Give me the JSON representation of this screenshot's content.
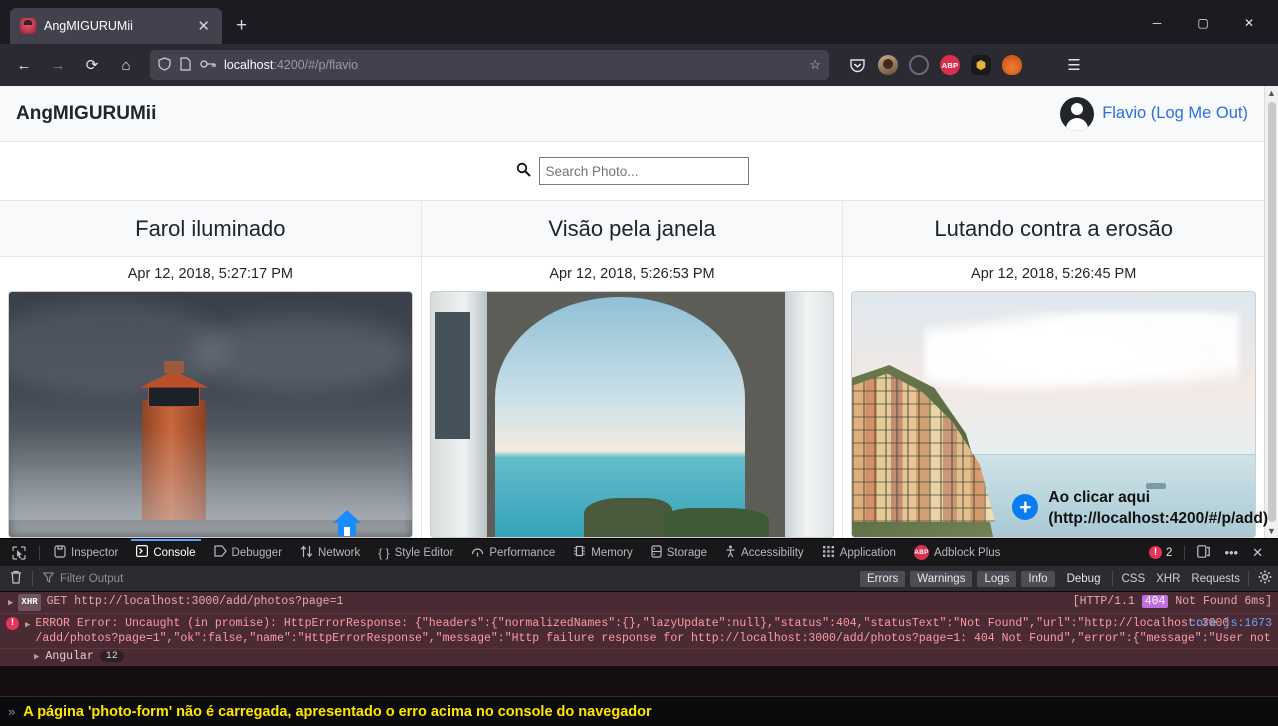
{
  "browser": {
    "tab": {
      "title": "AngMIGURUMii",
      "close_label": "✕",
      "favicon": "bug-favicon"
    },
    "newtab_label": "+",
    "window_controls": {
      "minimize": "─",
      "maximize": "▢",
      "close": "✕"
    },
    "nav": {
      "back": "←",
      "forward": "→",
      "reload": "⟳",
      "home": "⌂"
    },
    "url": {
      "protocol_host": "localhost",
      "rest": ":4200/#/p/flavio",
      "full": "localhost:4200/#/p/flavio"
    },
    "urlbar_icons": [
      "shield-icon",
      "page-icon",
      "key-icon"
    ],
    "bookmark_star": "☆",
    "extensions": [
      {
        "name": "pocket-icon",
        "glyph": ""
      },
      {
        "name": "profile-avatar-icon",
        "glyph": ""
      },
      {
        "name": "circle-extension-icon",
        "glyph": ""
      },
      {
        "name": "adblock-plus-icon",
        "glyph": "ABP"
      },
      {
        "name": "gold-extension-icon",
        "glyph": "⬢"
      },
      {
        "name": "metamask-fox-icon",
        "glyph": ""
      },
      {
        "name": "windows-extension-icon",
        "glyph": ""
      },
      {
        "name": "app-menu-icon",
        "glyph": "☰"
      }
    ]
  },
  "app": {
    "brand": "AngMIGURUMii",
    "user_link": "Flavio (Log Me Out)",
    "search": {
      "placeholder": "Search Photo...",
      "value": "",
      "icon": "search-icon"
    },
    "photos": [
      {
        "title": "Farol iluminado",
        "date": "Apr 12, 2018, 5:27:17 PM",
        "image": "lighthouse-storm-photo"
      },
      {
        "title": "Visão pela janela",
        "date": "Apr 12, 2018, 5:26:53 PM",
        "image": "stone-arch-sea-photo"
      },
      {
        "title": "Lutando contra a erosão",
        "date": "Apr 12, 2018, 5:26:45 PM",
        "image": "cliff-village-photo"
      }
    ],
    "home_button_icon": "home-icon",
    "annotation": {
      "plus_glyph": "+",
      "line1": "Ao clicar aqui",
      "line2": "(http://localhost:4200/#/p/add)"
    }
  },
  "devtools": {
    "picker_icon": "element-picker-icon",
    "tabs": [
      {
        "label": "Inspector",
        "icon": "inspector-icon",
        "active": false
      },
      {
        "label": "Console",
        "icon": "console-icon",
        "active": true
      },
      {
        "label": "Debugger",
        "icon": "debugger-icon",
        "active": false
      },
      {
        "label": "Network",
        "icon": "network-icon",
        "active": false
      },
      {
        "label": "Style Editor",
        "icon": "style-editor-icon",
        "active": false
      },
      {
        "label": "Performance",
        "icon": "performance-icon",
        "active": false
      },
      {
        "label": "Memory",
        "icon": "memory-icon",
        "active": false
      },
      {
        "label": "Storage",
        "icon": "storage-icon",
        "active": false
      },
      {
        "label": "Accessibility",
        "icon": "accessibility-icon",
        "active": false
      },
      {
        "label": "Application",
        "icon": "application-icon",
        "active": false
      },
      {
        "label": "Adblock Plus",
        "icon": "adblock-plus-icon",
        "active": false
      }
    ],
    "error_count": "2",
    "dock_icon": "dock-icon",
    "meatball_icon": "more-options-icon",
    "close_icon": "close-icon",
    "filterbar": {
      "trash_icon": "clear-console-icon",
      "filter_icon": "filter-icon",
      "filter_placeholder": "Filter Output",
      "buttons": [
        {
          "label": "Errors",
          "active": true
        },
        {
          "label": "Warnings",
          "active": true
        },
        {
          "label": "Logs",
          "active": true
        },
        {
          "label": "Info",
          "active": true
        },
        {
          "label": "Debug",
          "active": false
        }
      ],
      "extra": [
        "CSS",
        "XHR",
        "Requests"
      ],
      "settings_icon": "gear-icon"
    },
    "logs": {
      "network": {
        "method_url": "GET http://localhost:3000/add/photos?page=1",
        "tag": "XHR",
        "status_prefix": "[HTTP/1.1 ",
        "status_code": "404",
        "status_suffix": " Not Found 6ms]"
      },
      "error": {
        "line1": "ERROR Error: Uncaught (in promise): HttpErrorResponse: {\"headers\":{\"normalizedNames\":{},\"lazyUpdate\":null},\"status\":404,\"statusText\":\"Not Found\",\"url\":\"http://localhost:3000",
        "line2": "/add/photos?page=1\",\"ok\":false,\"name\":\"HttpErrorResponse\",\"message\":\"Http failure response for http://localhost:3000/add/photos?page=1: 404 Not Found\",\"error\":{\"message\":\"User not found\"}}",
        "source": "core.js:1673",
        "stack_label": "Angular",
        "stack_count": "12"
      }
    },
    "input": {
      "prompt": "»",
      "text": "A página 'photo-form' não é carregada,  apresentado o erro acima no console do navegador"
    }
  },
  "colors": {
    "accent": "#2a6ee0",
    "error": "#e5345a",
    "warning_text": "#ffe600",
    "devtools_active": "#5b9dfb"
  }
}
